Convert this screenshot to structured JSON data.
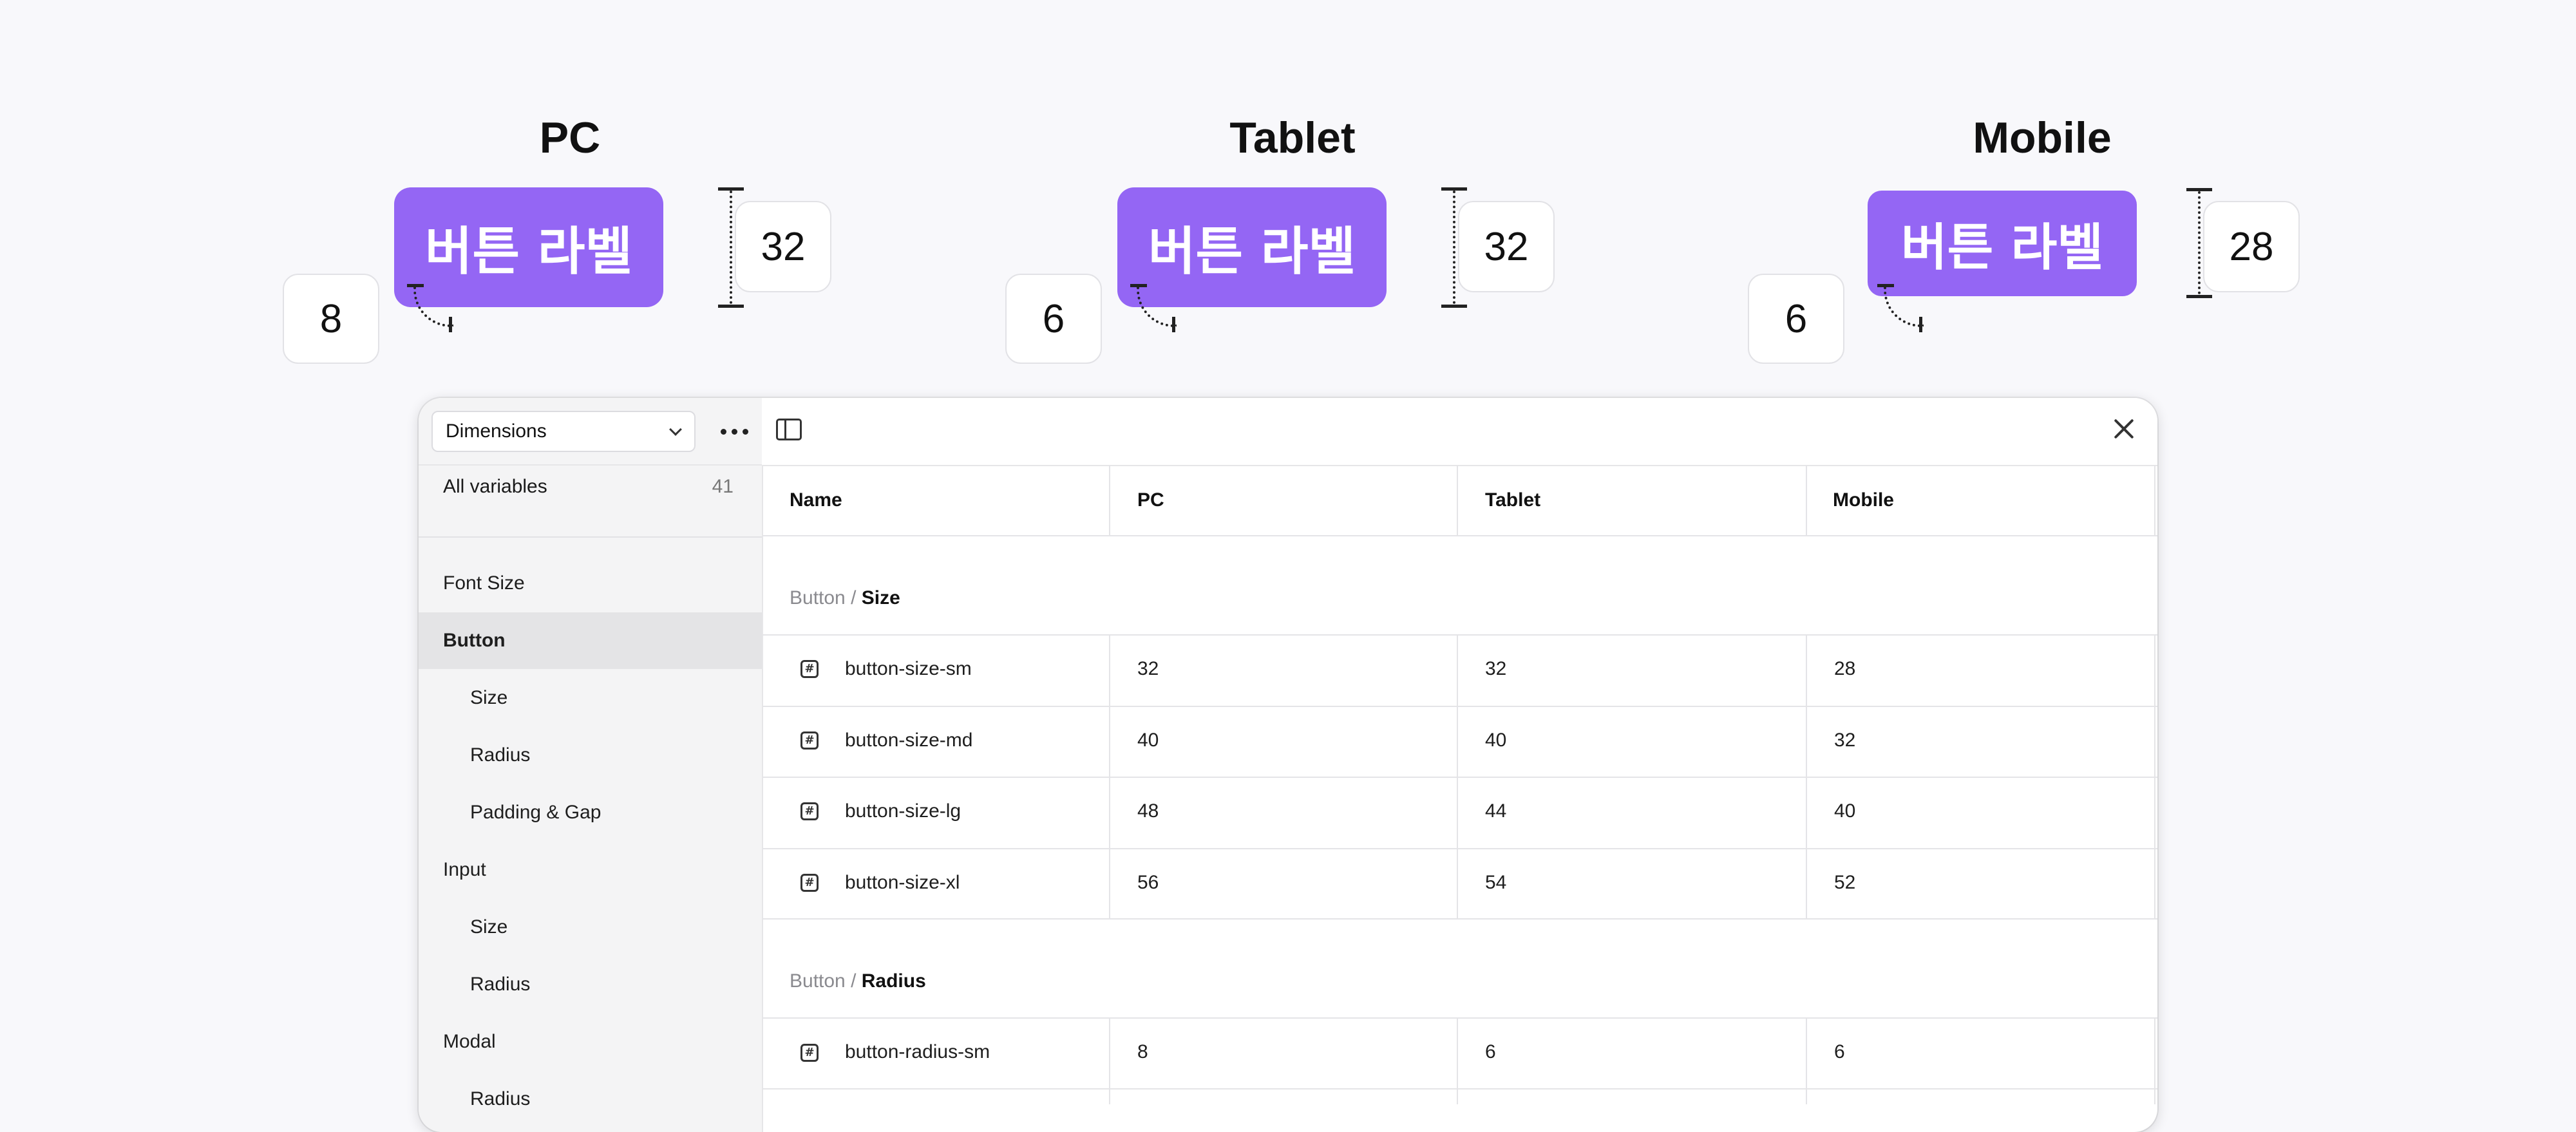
{
  "preview": {
    "devices": [
      {
        "title": "PC",
        "button_label": "버튼 라벨",
        "radius": "8",
        "height": "32"
      },
      {
        "title": "Tablet",
        "button_label": "버튼 라벨",
        "radius": "6",
        "height": "32"
      },
      {
        "title": "Mobile",
        "button_label": "버튼 라벨",
        "radius": "6",
        "height": "28"
      }
    ],
    "accent": "#9466f4"
  },
  "sidebar": {
    "collection": "Dimensions",
    "all_variables": {
      "label": "All variables",
      "count": "41"
    },
    "groups": [
      {
        "label": "Font Size"
      },
      {
        "label": "Button",
        "selected": true
      },
      {
        "label": "Size"
      },
      {
        "label": "Radius"
      },
      {
        "label": "Padding & Gap"
      },
      {
        "label": "Input"
      },
      {
        "label": "Size"
      },
      {
        "label": "Radius"
      },
      {
        "label": "Modal"
      },
      {
        "label": "Radius"
      }
    ]
  },
  "table": {
    "columns": [
      "Name",
      "PC",
      "Tablet",
      "Mobile"
    ],
    "sections": [
      {
        "group": "Button",
        "sep": " / ",
        "name": "Size",
        "rows": [
          {
            "name": "button-size-sm",
            "pc": "32",
            "tablet": "32",
            "mobile": "28"
          },
          {
            "name": "button-size-md",
            "pc": "40",
            "tablet": "40",
            "mobile": "32"
          },
          {
            "name": "button-size-lg",
            "pc": "48",
            "tablet": "44",
            "mobile": "40"
          },
          {
            "name": "button-size-xl",
            "pc": "56",
            "tablet": "54",
            "mobile": "52"
          }
        ]
      },
      {
        "group": "Button",
        "sep": " / ",
        "name": "Radius",
        "rows": [
          {
            "name": "button-radius-sm",
            "pc": "8",
            "tablet": "6",
            "mobile": "6"
          }
        ]
      }
    ],
    "number_icon_glyph": "#"
  }
}
